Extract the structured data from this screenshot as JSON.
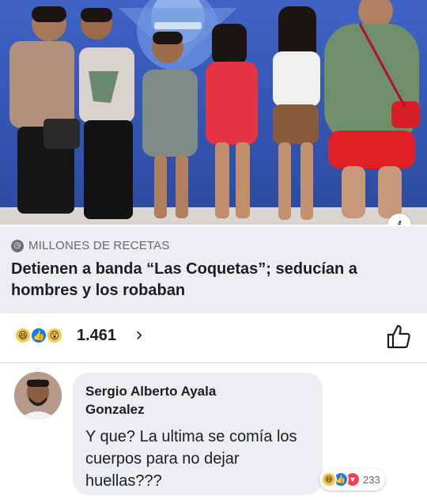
{
  "post": {
    "photo": {
      "alt_icon": "info-icon",
      "info_label": "i",
      "colors": {
        "wall": "#3a5bbd",
        "floor": "#d9d6d2"
      }
    },
    "link": {
      "source_icon": "clock-icon",
      "source": "MILLONES DE RECETAS",
      "headline": "Detienen a banda “Las Coquetas”; seducían a hombres y los robaban"
    },
    "reactions": {
      "icons": [
        "haha-icon",
        "like-icon",
        "wow-icon"
      ],
      "count": "1.461",
      "chevron": "›",
      "like_icon": "thumbs-up-outline-icon"
    }
  },
  "comment": {
    "author": "Sergio Alberto Ayala Gonzalez",
    "text": "Y que? La ultima se comía los cuerpos para no dejar huellas???",
    "reactions": {
      "icons": [
        "haha-icon",
        "like-icon",
        "love-icon"
      ],
      "count": "233"
    }
  }
}
